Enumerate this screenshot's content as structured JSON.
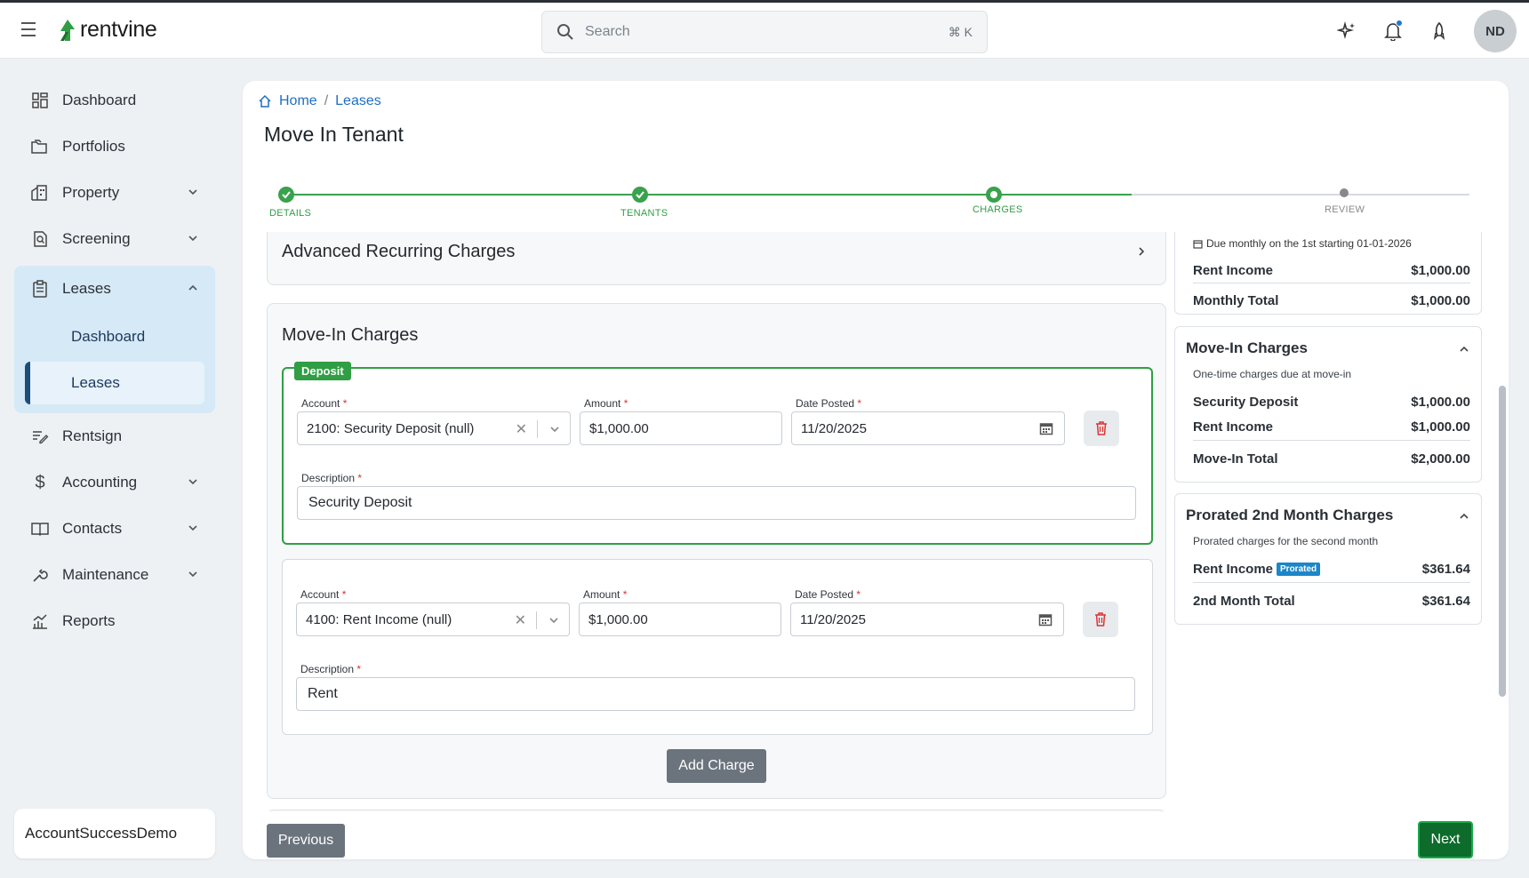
{
  "app": {
    "logo_text": "rentvine"
  },
  "search": {
    "placeholder": "Search",
    "shortcut": "⌘ K"
  },
  "user": {
    "initials": "ND"
  },
  "sidebar": {
    "items": [
      {
        "label": "Dashboard",
        "icon": "dashboard-icon"
      },
      {
        "label": "Portfolios",
        "icon": "folders-icon"
      },
      {
        "label": "Property",
        "icon": "building-icon"
      },
      {
        "label": "Screening",
        "icon": "screening-icon"
      },
      {
        "label": "Leases",
        "icon": "clipboard-icon"
      },
      {
        "label": "Rentsign",
        "icon": "signature-icon"
      },
      {
        "label": "Accounting",
        "icon": "dollar-icon"
      },
      {
        "label": "Contacts",
        "icon": "book-icon"
      },
      {
        "label": "Maintenance",
        "icon": "wrench-icon"
      },
      {
        "label": "Reports",
        "icon": "chart-icon"
      }
    ],
    "leases_sub": [
      "Dashboard",
      "Leases"
    ],
    "account_name": "AccountSuccessDemo"
  },
  "breadcrumb": {
    "home": "Home",
    "sep": "/",
    "current": "Leases"
  },
  "page_title": "Move In Tenant",
  "stepper": {
    "steps": [
      "DETAILS",
      "TENANTS",
      "CHARGES",
      "REVIEW"
    ],
    "current_index": 2
  },
  "advanced": {
    "title": "Advanced Recurring Charges"
  },
  "movein": {
    "title": "Move-In Charges",
    "deposit_tag": "Deposit",
    "labels": {
      "account": "Account",
      "amount": "Amount",
      "date": "Date Posted",
      "description": "Description",
      "req": "*"
    },
    "charges": [
      {
        "account": "2100: Security Deposit (null)",
        "amount": "$1,000.00",
        "date": "11/20/2025",
        "description": "Security Deposit"
      },
      {
        "account": "4100: Rent Income (null)",
        "amount": "$1,000.00",
        "date": "11/20/2025",
        "description": "Rent"
      }
    ],
    "add_charge": "Add Charge"
  },
  "summary": {
    "monthly": {
      "note": "Due monthly on the 1st starting 01-01-2026",
      "rows": [
        {
          "label": "Rent Income",
          "value": "$1,000.00"
        }
      ],
      "total_label": "Monthly Total",
      "total_value": "$1,000.00"
    },
    "movein": {
      "title": "Move-In Charges",
      "subtitle": "One-time charges due at move-in",
      "rows": [
        {
          "label": "Security Deposit",
          "value": "$1,000.00"
        },
        {
          "label": "Rent Income",
          "value": "$1,000.00"
        }
      ],
      "total_label": "Move-In Total",
      "total_value": "$2,000.00"
    },
    "prorated": {
      "title": "Prorated 2nd Month Charges",
      "subtitle": "Prorated charges for the second month",
      "row_label": "Rent Income",
      "badge": "Prorated",
      "row_value": "$361.64",
      "total_label": "2nd Month Total",
      "total_value": "$361.64"
    }
  },
  "footer": {
    "previous": "Previous",
    "next": "Next"
  },
  "colors": {
    "brand_green": "#2f9e44",
    "link_blue": "#1f6fc0",
    "next_green": "#0d6b2c"
  }
}
